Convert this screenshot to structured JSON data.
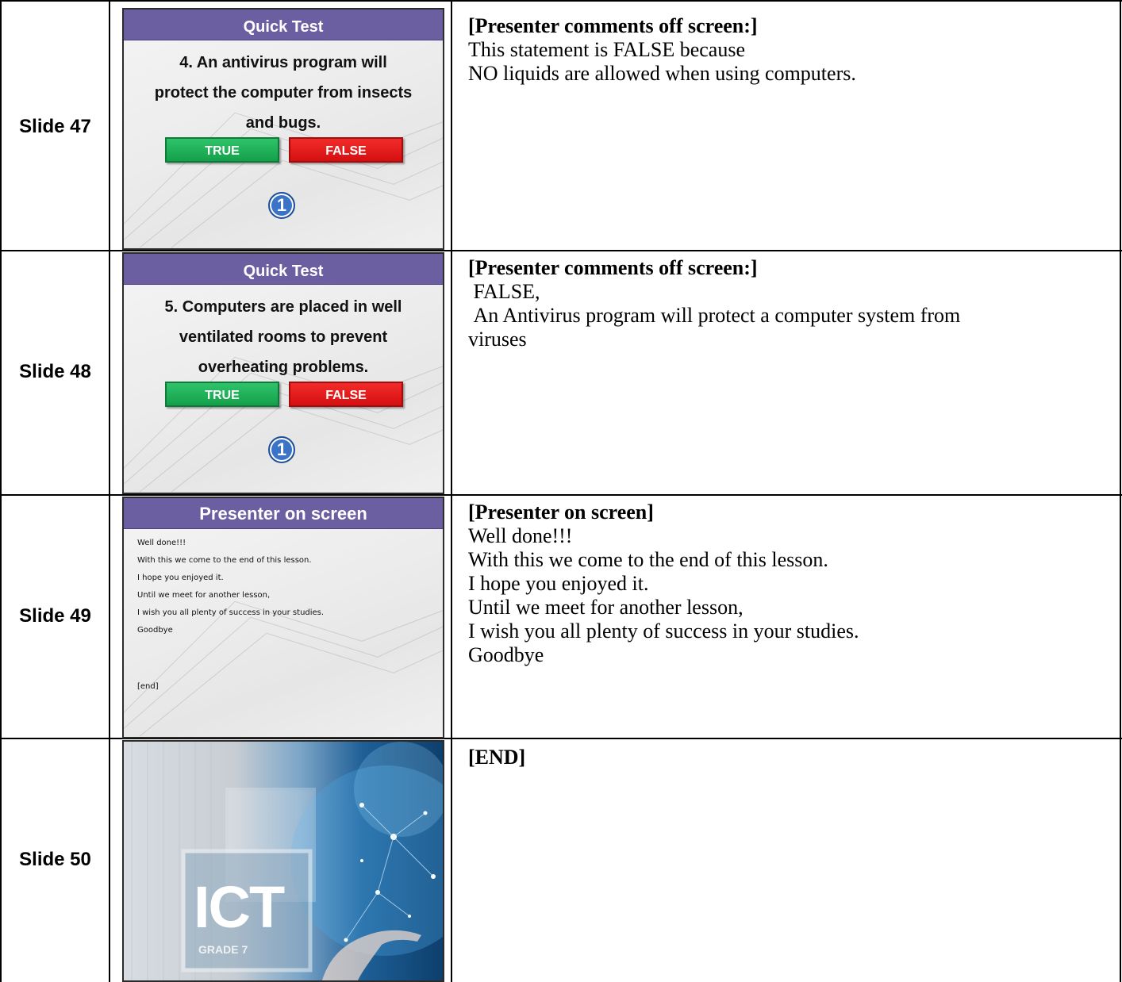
{
  "rows": [
    {
      "label": "Slide 47",
      "slide": {
        "header": "Quick Test",
        "question_lines": [
          "4. An antivirus program  will",
          "protect the computer from insects",
          "and bugs."
        ],
        "true_label": "TRUE",
        "false_label": "FALSE",
        "badge": "1"
      },
      "notes": {
        "heading": "[Presenter comments off screen:]",
        "lines": [
          "This statement is FALSE because",
          "NO liquids are allowed when using computers."
        ]
      }
    },
    {
      "label": "Slide 48",
      "slide": {
        "header": "Quick Test",
        "question_lines": [
          "5. Computers are placed in well",
          "ventilated rooms to prevent",
          "overheating problems."
        ],
        "true_label": "TRUE",
        "false_label": "FALSE",
        "badge": "1"
      },
      "notes": {
        "heading": "[Presenter comments off screen:]",
        "lines": [
          " FALSE,",
          " An Antivirus program will protect a computer system from",
          "viruses"
        ]
      }
    },
    {
      "label": "Slide 49",
      "slide": {
        "header": "Presenter on screen",
        "lines": [
          "Well done!!!",
          "With this we come to the end of this lesson.",
          "I hope you enjoyed it.",
          "Until we meet for another lesson,",
          "I wish you all plenty of success in your studies.",
          "Goodbye"
        ],
        "end": "[end]"
      },
      "notes": {
        "heading": "[Presenter on screen]",
        "lines": [
          "Well done!!!",
          "With this we come to the end of this lesson.",
          "I hope you enjoyed it.",
          "Until we meet for another lesson,",
          "I wish you all plenty of success in your studies.",
          "Goodbye"
        ]
      }
    },
    {
      "label": "Slide 50",
      "slide": {
        "title": "ICT",
        "subtitle": "GRADE 7"
      },
      "notes": {
        "heading": "[END]",
        "lines": []
      }
    }
  ],
  "colors": {
    "header_purple": "#6c5fa1",
    "true_green": "#1fb155",
    "false_red": "#e81818",
    "badge_blue": "#3a73c8"
  }
}
